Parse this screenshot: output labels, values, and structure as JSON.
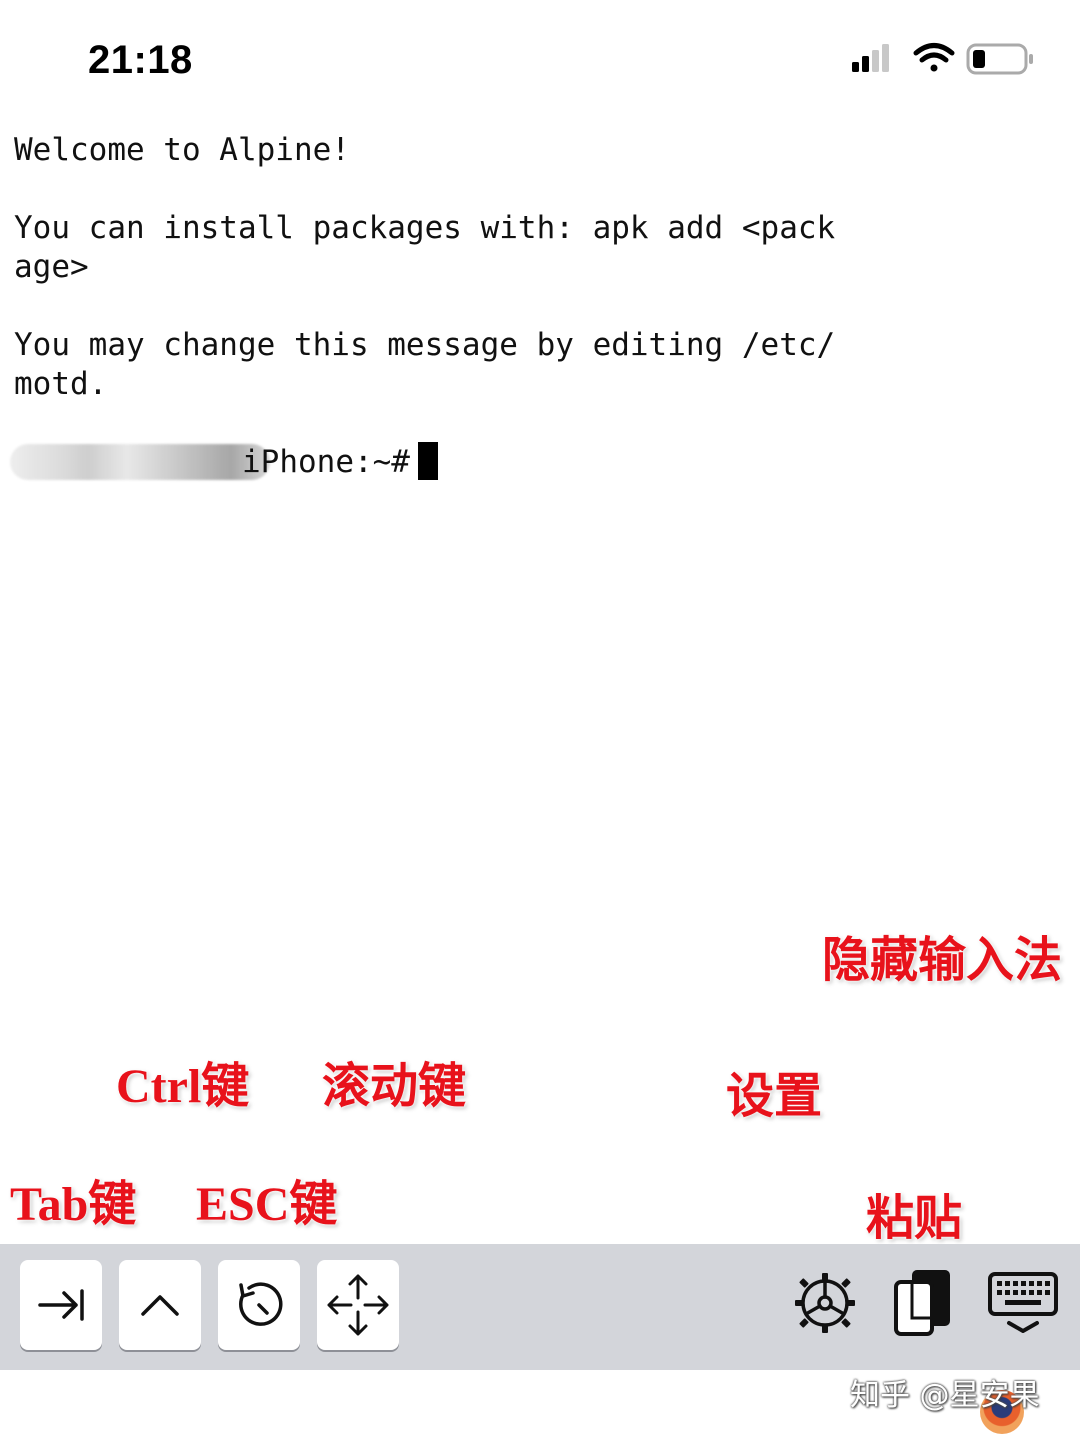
{
  "status_bar": {
    "time": "21:18",
    "icons": [
      "cellular-signal-icon",
      "wifi-icon",
      "battery-icon"
    ]
  },
  "terminal": {
    "lines": [
      "Welcome to Alpine!",
      "",
      "You can install packages with: apk add <pack",
      "age>",
      "",
      "You may change this message by editing /etc/",
      "motd.",
      ""
    ],
    "prompt_visible": "iPhone:~#"
  },
  "annotations": {
    "hide_keyboard": "隐藏输入法",
    "ctrl_key": "Ctrl键",
    "scroll_key": "滚动键",
    "settings": "设置",
    "tab_key": "Tab键",
    "esc_key": "ESC键",
    "paste": "粘贴"
  },
  "toolbar": {
    "keys": [
      {
        "name": "tab-key",
        "icon": "tab-arrow-icon"
      },
      {
        "name": "ctrl-key",
        "icon": "caret-up-icon"
      },
      {
        "name": "esc-key",
        "icon": "history-clock-icon"
      },
      {
        "name": "scroll-key",
        "icon": "move-arrows-icon"
      }
    ],
    "right_icons": [
      "settings-gear-icon",
      "paste-clipboard-icon",
      "hide-keyboard-icon"
    ]
  },
  "watermark": "知乎 @星安果",
  "colors": {
    "annotation": "#e8121b",
    "toolbar_bg": "#d3d5da",
    "key_bg": "#ffffff"
  }
}
